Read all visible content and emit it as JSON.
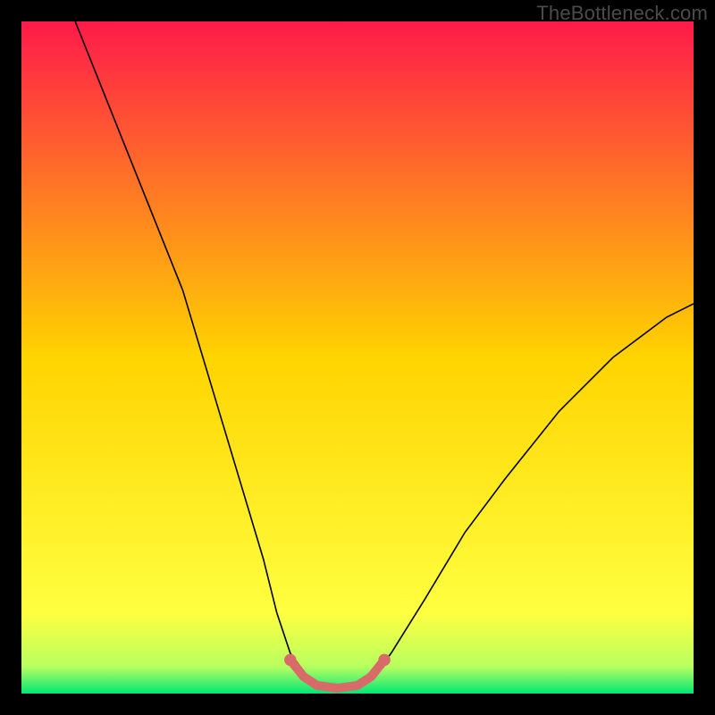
{
  "watermark": "TheBottleneck.com",
  "chart_data": {
    "type": "line",
    "title": "",
    "xlabel": "",
    "ylabel": "",
    "xlim": [
      0,
      100
    ],
    "ylim": [
      0,
      100
    ],
    "grid": false,
    "legend": false,
    "background_gradient": {
      "stops": [
        {
          "pos": 0.0,
          "color": "#ff1a4a"
        },
        {
          "pos": 0.5,
          "color": "#ffd400"
        },
        {
          "pos": 0.88,
          "color": "#ffff40"
        },
        {
          "pos": 0.96,
          "color": "#b8ff60"
        },
        {
          "pos": 1.0,
          "color": "#00e676"
        }
      ]
    },
    "series": [
      {
        "name": "bottleneck-curve",
        "stroke": "#000000",
        "stroke_width": 1.6,
        "points": [
          {
            "x": 8,
            "y": 100
          },
          {
            "x": 12,
            "y": 90
          },
          {
            "x": 16,
            "y": 80
          },
          {
            "x": 20,
            "y": 70
          },
          {
            "x": 24,
            "y": 60
          },
          {
            "x": 27,
            "y": 50
          },
          {
            "x": 30,
            "y": 40
          },
          {
            "x": 33,
            "y": 30
          },
          {
            "x": 36,
            "y": 20
          },
          {
            "x": 38,
            "y": 12
          },
          {
            "x": 40,
            "y": 6
          },
          {
            "x": 43,
            "y": 2
          },
          {
            "x": 46,
            "y": 1
          },
          {
            "x": 49,
            "y": 1
          },
          {
            "x": 52,
            "y": 2
          },
          {
            "x": 55,
            "y": 6
          },
          {
            "x": 60,
            "y": 14
          },
          {
            "x": 66,
            "y": 24
          },
          {
            "x": 72,
            "y": 32
          },
          {
            "x": 80,
            "y": 42
          },
          {
            "x": 88,
            "y": 50
          },
          {
            "x": 96,
            "y": 56
          },
          {
            "x": 100,
            "y": 58
          }
        ]
      },
      {
        "name": "optimal-band",
        "stroke": "#d96a6a",
        "stroke_width": 10,
        "linecap": "round",
        "points": [
          {
            "x": 40,
            "y": 5
          },
          {
            "x": 42,
            "y": 2.5
          },
          {
            "x": 44,
            "y": 1.2
          },
          {
            "x": 47,
            "y": 0.8
          },
          {
            "x": 50,
            "y": 1.2
          },
          {
            "x": 52,
            "y": 2.5
          },
          {
            "x": 54,
            "y": 5
          }
        ],
        "endpoints": [
          {
            "x": 40,
            "y": 5
          },
          {
            "x": 54,
            "y": 5
          }
        ]
      }
    ]
  }
}
